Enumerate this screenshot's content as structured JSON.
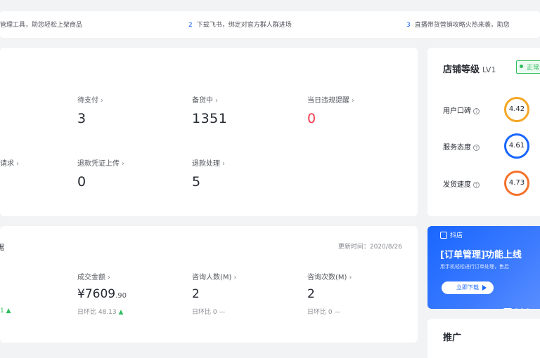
{
  "notice": {
    "item1": "管理工具，助您轻松上架商品",
    "item2_num": "2",
    "item2": "下载飞书，绑定对官方群人群进场",
    "item3_num": "3",
    "item3": "直播带货营销攻略火热来袭，助您"
  },
  "orders": {
    "stats": [
      {
        "label": "待支付",
        "value": "3"
      },
      {
        "label": "备货中",
        "value": "1351"
      },
      {
        "label": "当日违规提醒",
        "value": "0"
      },
      {
        "label": "请求",
        "value": ""
      },
      {
        "label": "退款凭证上传",
        "value": "0"
      },
      {
        "label": "退款处理",
        "value": "5"
      }
    ]
  },
  "data_panel": {
    "title": "据",
    "update_time": "更新时间：2020/8/26",
    "partial_compare": "1",
    "stats": [
      {
        "label": "成交金额",
        "value_main": "¥7609",
        "value_decimal": ".90",
        "compare": "日环比 48.13"
      },
      {
        "label": "咨询人数(M)",
        "value_main": "2",
        "value_decimal": "",
        "compare": "日环比 0 —"
      },
      {
        "label": "咨询次数(M)",
        "value_main": "2",
        "value_decimal": "",
        "compare": "日环比 0 —"
      }
    ]
  },
  "shop": {
    "title": "店铺等级",
    "level": "LV1",
    "status": "正常",
    "scores": [
      {
        "label": "用户口碑",
        "value": "4.42",
        "color": "#f5a623"
      },
      {
        "label": "服务态度",
        "value": "4.61",
        "color": "#1966ff"
      },
      {
        "label": "发货速度",
        "value": "4.73",
        "color": "#f5712b"
      }
    ]
  },
  "banner": {
    "tag": "抖店",
    "headline": "[订单管理]功能上线",
    "subtitle": "用手机轻松进行订单处理，售后",
    "button": "立即下载"
  },
  "promo": {
    "title": "推广"
  }
}
